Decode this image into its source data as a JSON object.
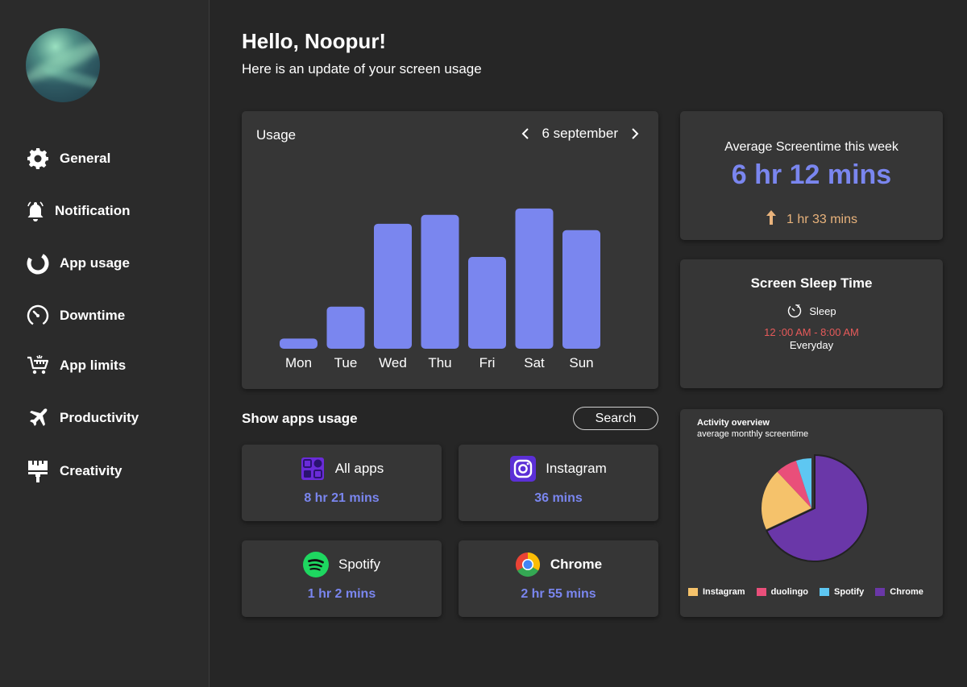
{
  "sidebar": {
    "items": [
      {
        "label": "General",
        "icon": "gear-icon"
      },
      {
        "label": "Notification",
        "icon": "bell-icon"
      },
      {
        "label": "App usage",
        "icon": "ring-chart-icon"
      },
      {
        "label": "Downtime",
        "icon": "speedometer-icon"
      },
      {
        "label": "App limits",
        "icon": "cart-icon"
      },
      {
        "label": "Productivity",
        "icon": "airplane-icon"
      },
      {
        "label": "Creativity",
        "icon": "paint-roller-icon"
      }
    ]
  },
  "header": {
    "greeting": "Hello, Noopur!",
    "subtitle": "Here is an update of your screen usage"
  },
  "usage": {
    "title": "Usage",
    "date": "6 september"
  },
  "average": {
    "heading": "Average Screentime this week",
    "value": "6 hr 12 mins",
    "delta": "1 hr 33 mins",
    "delta_direction": "up"
  },
  "sleep": {
    "heading": "Screen Sleep Time",
    "label": "Sleep",
    "time": "12 :00 AM - 8:00 AM",
    "repeat": "Everyday"
  },
  "apps": {
    "heading": "Show apps usage",
    "search_label": "Search",
    "items": [
      {
        "name": "All apps",
        "time": "8 hr 21 mins",
        "icon": "all-apps-icon"
      },
      {
        "name": "Instagram",
        "time": "36 mins",
        "icon": "instagram-icon"
      },
      {
        "name": "Spotify",
        "time": "1 hr 2 mins",
        "icon": "spotify-icon"
      },
      {
        "name": "Chrome",
        "time": "2 hr 55 mins",
        "icon": "chrome-icon"
      }
    ]
  },
  "activity": {
    "heading": "Activity overview",
    "subheading": "average monthly screentime"
  },
  "colors": {
    "accent": "#7a86ef",
    "delta": "#e9b37c",
    "sleep_time": "#e75a5a",
    "instagram": "#f5c26b",
    "duolingo": "#e94f7a",
    "spotify": "#5ec7f2",
    "chrome": "#6a37a8"
  },
  "chart_data": [
    {
      "type": "bar",
      "categories": [
        "Mon",
        "Tue",
        "Wed",
        "Thu",
        "Fri",
        "Sat",
        "Sun"
      ],
      "values": [
        0.08,
        0.33,
        0.98,
        1.05,
        0.72,
        1.1,
        0.93
      ],
      "ylim": [
        0,
        1.2
      ]
    },
    {
      "type": "pie",
      "labels": [
        "Instagram",
        "duolingo",
        "Spotify",
        "Chrome"
      ],
      "values": [
        20,
        7,
        5,
        68
      ]
    }
  ]
}
